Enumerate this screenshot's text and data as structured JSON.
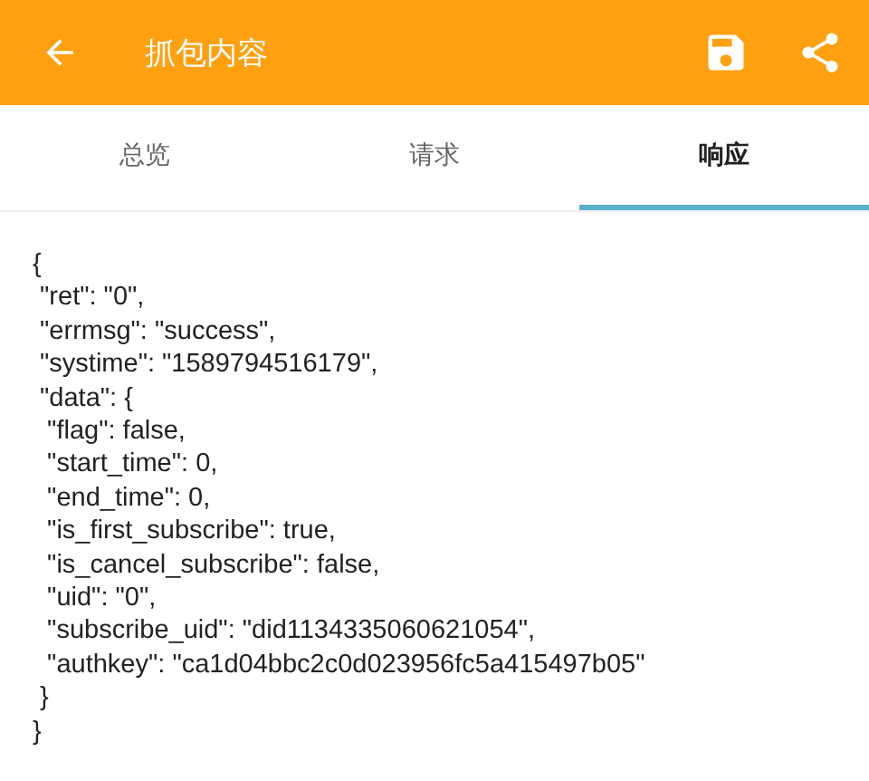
{
  "app_bar": {
    "title": "抓包内容"
  },
  "tabs": [
    {
      "label": "总览",
      "selected": false
    },
    {
      "label": "请求",
      "selected": false
    },
    {
      "label": "响应",
      "selected": true
    }
  ],
  "response_body": "{\n \"ret\": \"0\",\n \"errmsg\": \"success\",\n \"systime\": \"1589794516179\",\n \"data\": {\n  \"flag\": false,\n  \"start_time\": 0,\n  \"end_time\": 0,\n  \"is_first_subscribe\": true,\n  \"is_cancel_subscribe\": false,\n  \"uid\": \"0\",\n  \"subscribe_uid\": \"did1134335060621054\",\n  \"authkey\": \"ca1d04bbc2c0d023956fc5a415497b05\"\n }\n}"
}
